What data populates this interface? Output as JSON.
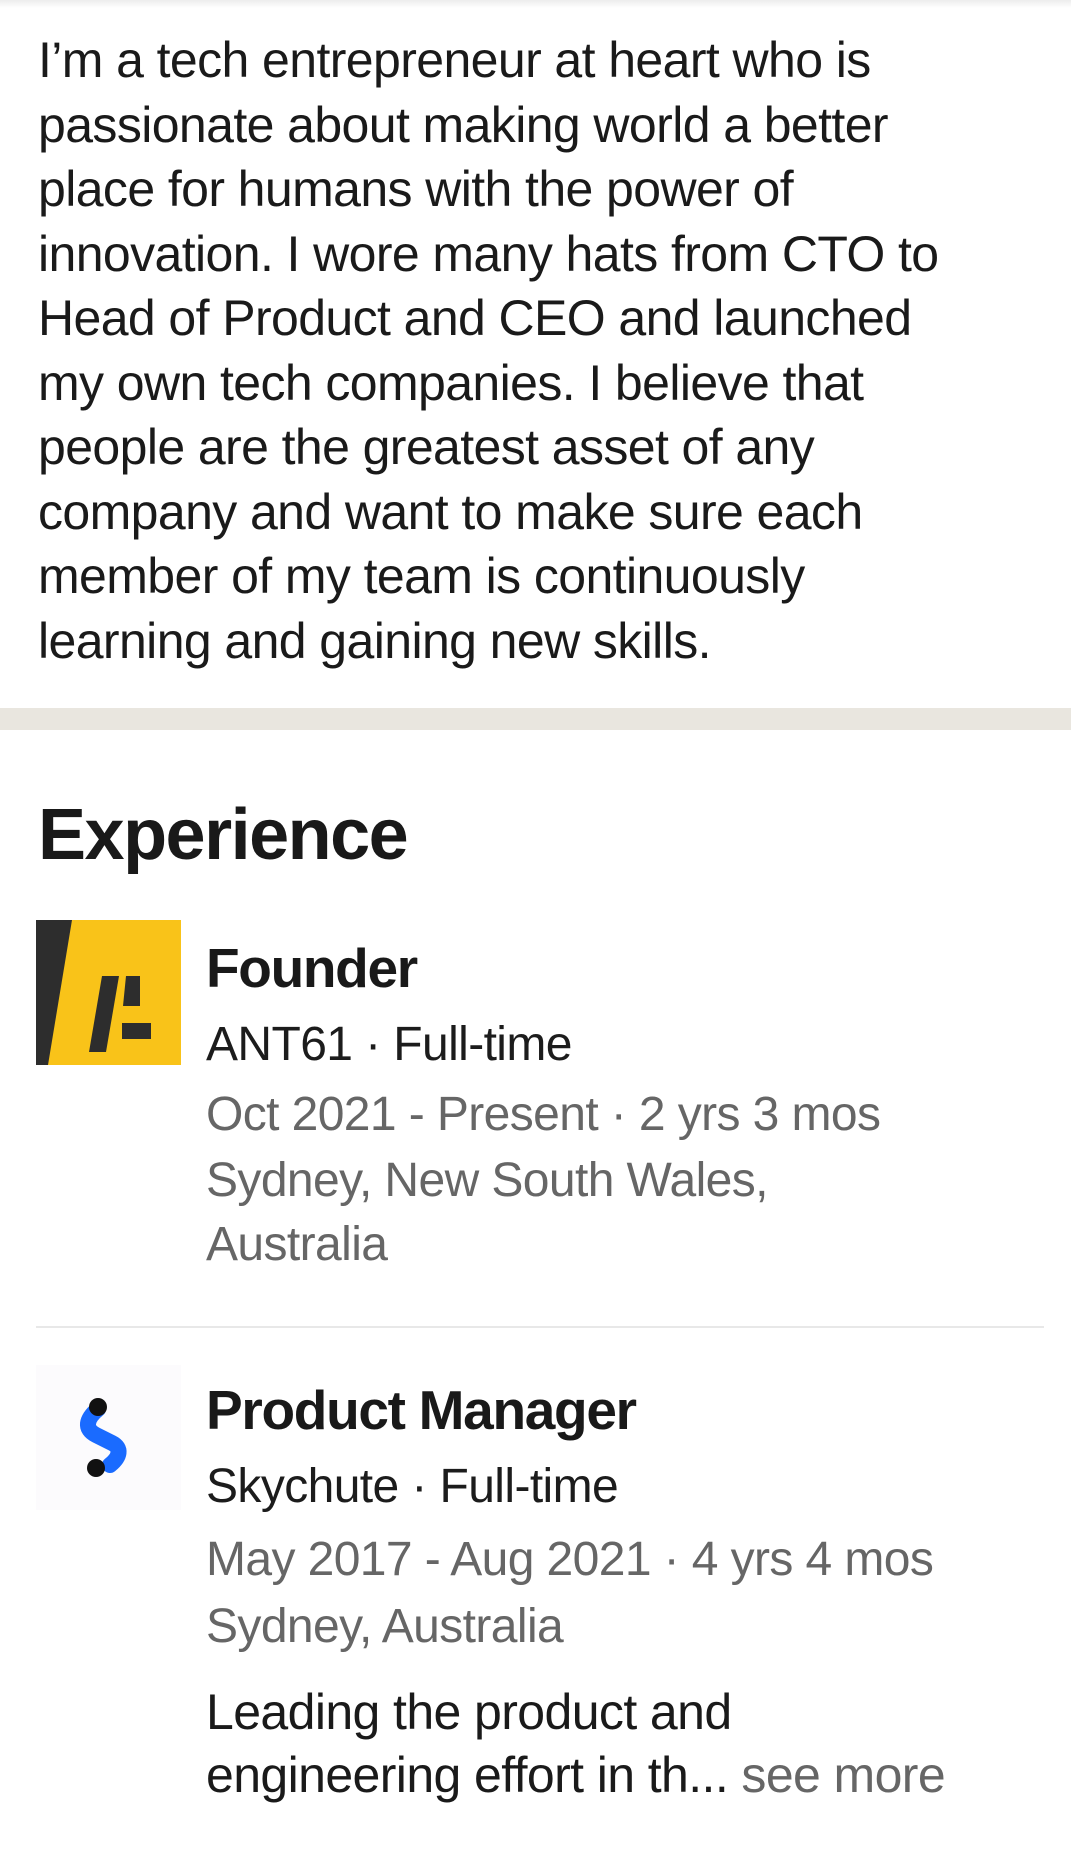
{
  "about": {
    "lines": [
      "I’m a tech entrepreneur at heart who is",
      "passionate about making world a better",
      "place for humans with the power of",
      "innovation. I wore many hats from CTO to",
      "Head of Product and CEO and launched",
      "my own tech companies. I believe that",
      "people are the greatest asset of any",
      "company and want to make sure each",
      "member of my team is continuously",
      "learning and gaining new skills."
    ]
  },
  "experience": {
    "heading": "Experience",
    "entries": [
      {
        "title": "Founder",
        "company_line": "ANT61 · Full-time",
        "dates": "Oct 2021 - Present · 2 yrs 3 mos",
        "location_lines": [
          "Sydney, New South Wales,",
          "Australia"
        ],
        "logo_icon": "ant61-logo",
        "logo_colors": {
          "background": "#f9c319",
          "stripe": "#2d2d2d"
        }
      },
      {
        "title": "Product Manager",
        "company_line": "Skychute · Full-time",
        "dates": "May 2017 - Aug 2021 · 4 yrs 4 mos",
        "location": "Sydney, Australia",
        "description_lines": [
          "Leading the product and",
          "engineering effort in th..."
        ],
        "see_more": " see more",
        "logo_icon": "skychute-logo",
        "logo_colors": {
          "background": "#fcfbfd",
          "accent": "#1a6bff",
          "dot": "#111111"
        }
      }
    ]
  }
}
